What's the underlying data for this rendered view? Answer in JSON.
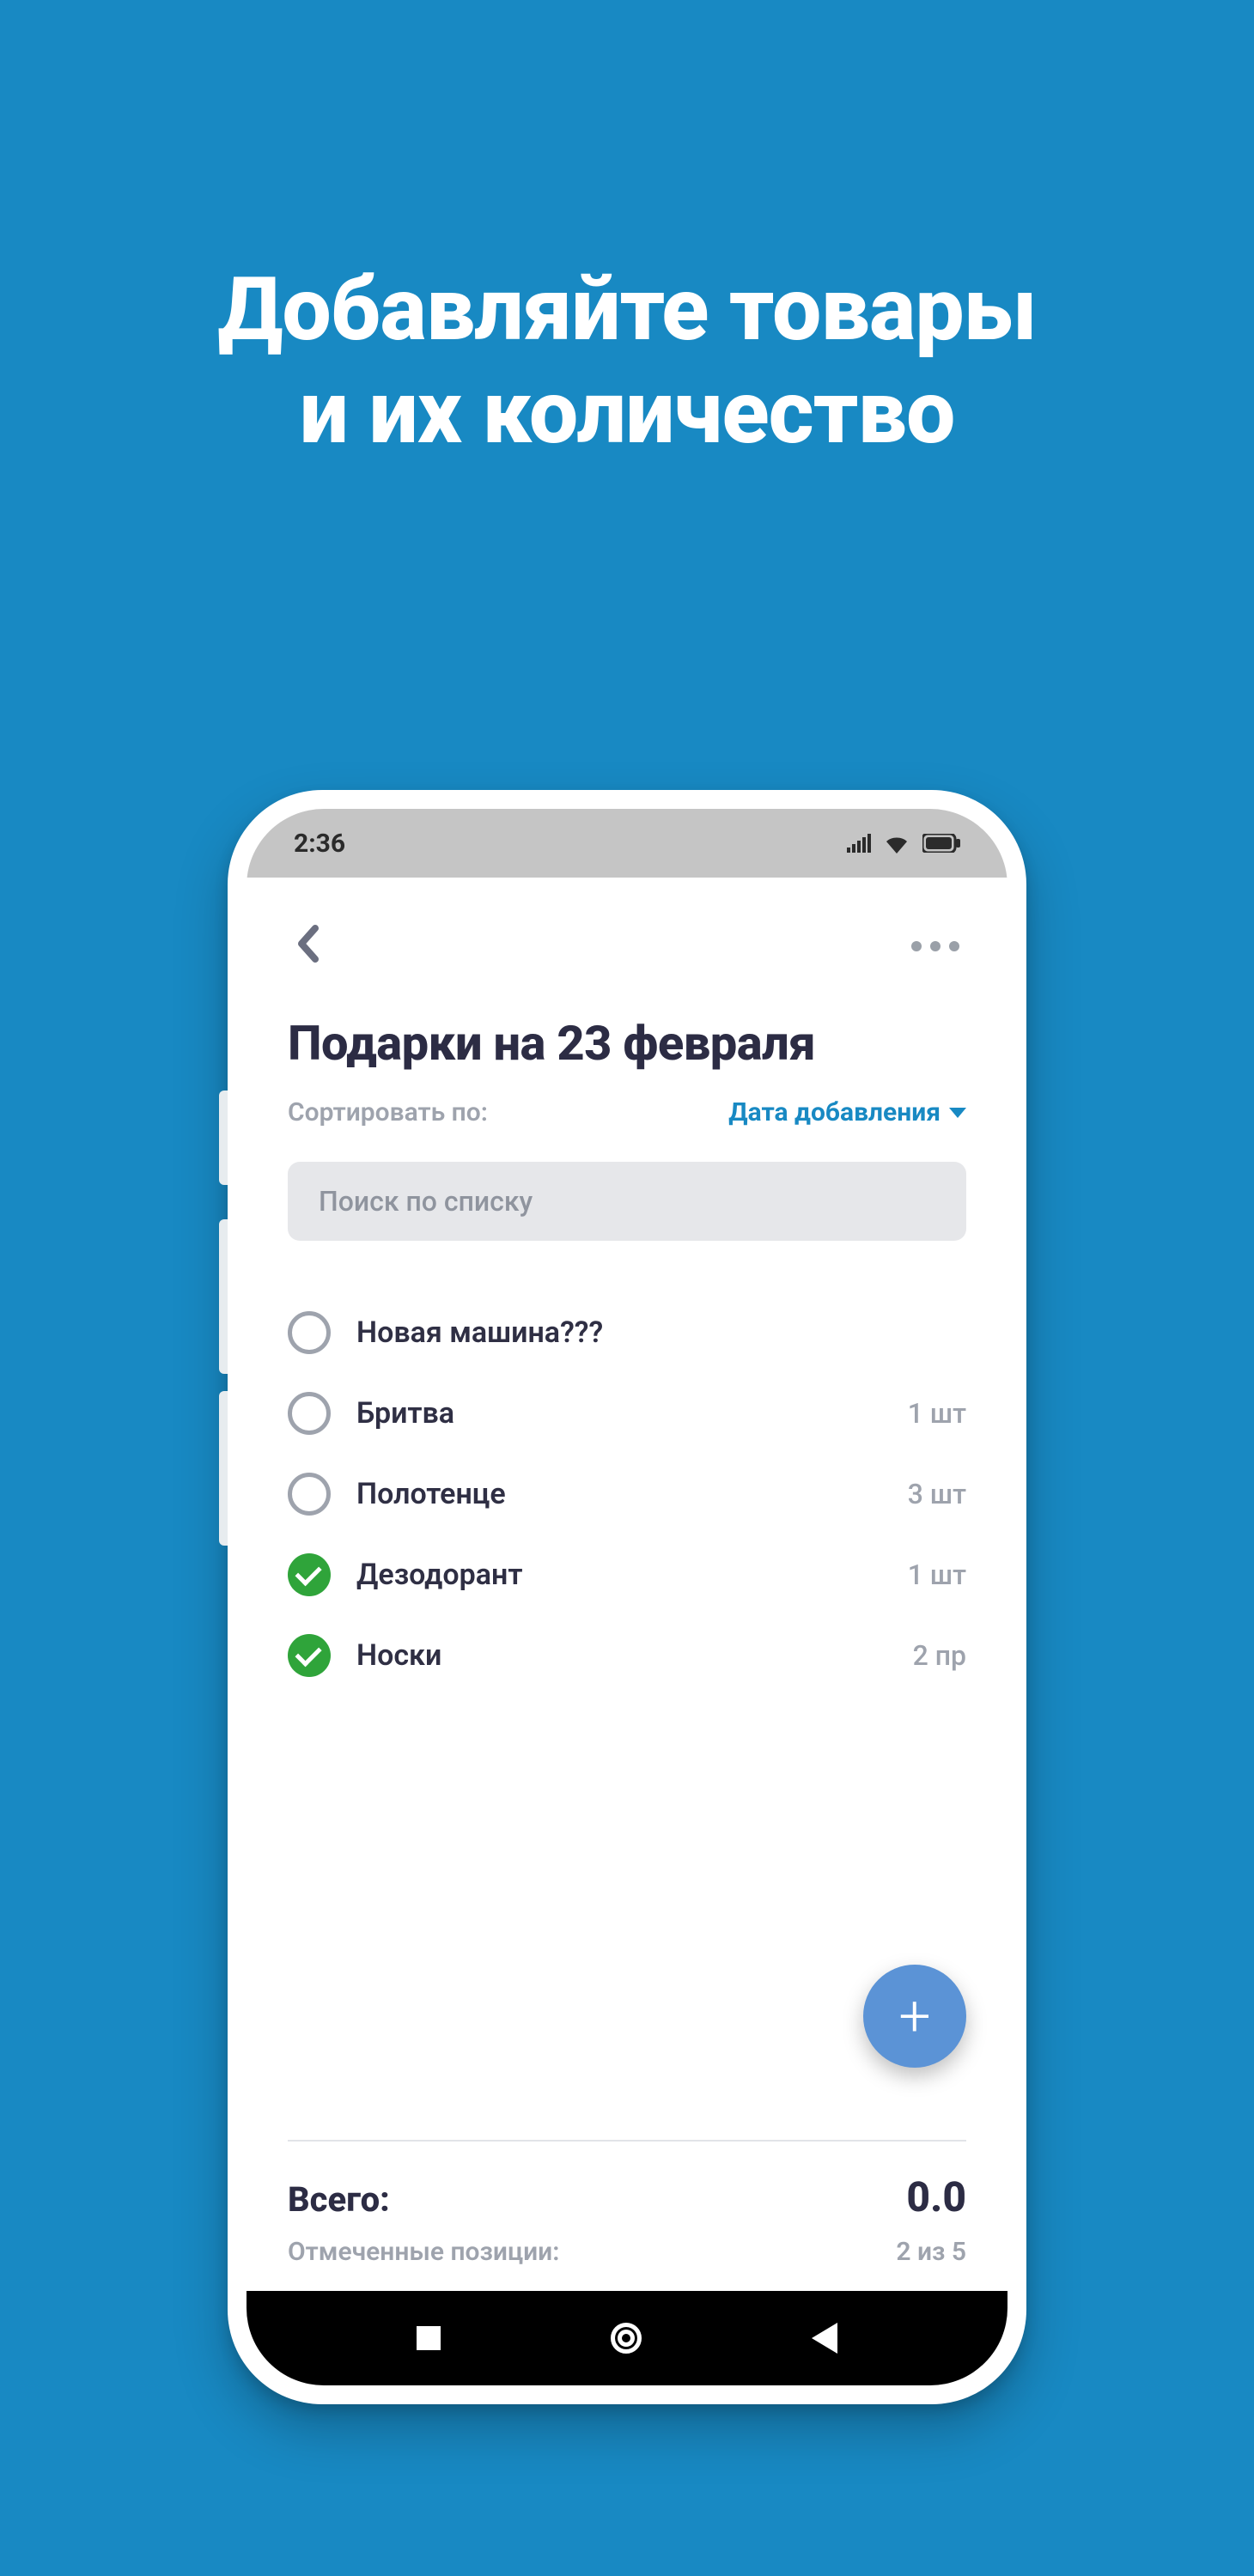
{
  "headline": {
    "line1": "Добавляйте товары",
    "line2": "и их количество"
  },
  "status": {
    "time": "2:36"
  },
  "header": {
    "title": "Подарки на 23 февраля"
  },
  "sort": {
    "label": "Сортировать по:",
    "value": "Дата добавления"
  },
  "search": {
    "placeholder": "Поиск по списку"
  },
  "items": [
    {
      "name": "Новая машина???",
      "qty": "",
      "checked": false
    },
    {
      "name": "Бритва",
      "qty": "1 шт",
      "checked": false
    },
    {
      "name": "Полотенце",
      "qty": "3 шт",
      "checked": false
    },
    {
      "name": "Дезодорант",
      "qty": "1 шт",
      "checked": true
    },
    {
      "name": "Носки",
      "qty": "2 пр",
      "checked": true
    }
  ],
  "fab": {
    "glyph": "+"
  },
  "summary": {
    "total_label": "Всего:",
    "total_value": "0.0",
    "marked_label": "Отмеченные позиции:",
    "marked_value": "2 из 5"
  },
  "colors": {
    "bg": "#1889c3",
    "accent_green": "#2fa43a",
    "fab_blue": "#5b93d6"
  }
}
